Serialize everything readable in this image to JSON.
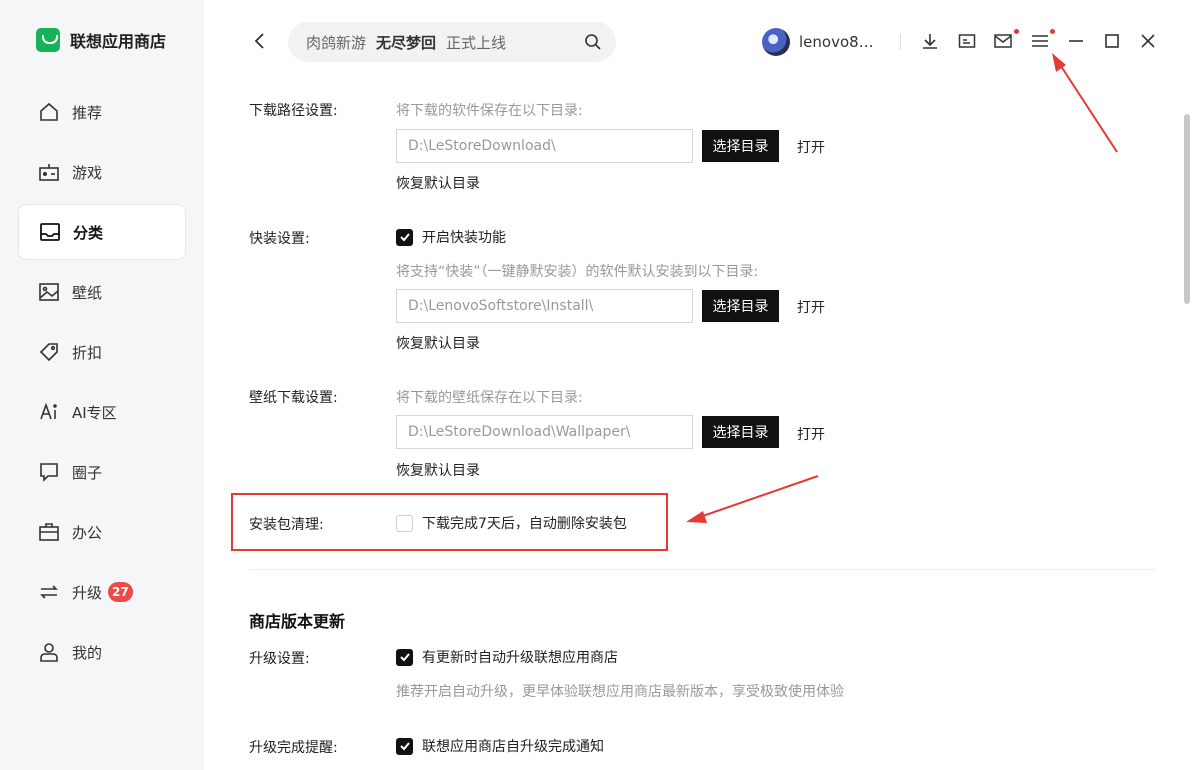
{
  "app": {
    "title": "联想应用商店"
  },
  "sidebar": {
    "items": [
      {
        "label": "推荐",
        "icon": "home-icon"
      },
      {
        "label": "游戏",
        "icon": "gamepad-icon"
      },
      {
        "label": "分类",
        "icon": "category-icon",
        "active": true
      },
      {
        "label": "壁纸",
        "icon": "image-icon"
      },
      {
        "label": "折扣",
        "icon": "tag-icon"
      },
      {
        "label": "AI专区",
        "icon": "ai-icon"
      },
      {
        "label": "圈子",
        "icon": "chat-icon"
      },
      {
        "label": "办公",
        "icon": "briefcase-icon"
      },
      {
        "label": "升级",
        "icon": "refresh-icon",
        "badge": "27"
      },
      {
        "label": "我的",
        "icon": "user-icon"
      }
    ]
  },
  "header": {
    "search": {
      "prefix": "肉鸽新游",
      "highlight": "无尽梦回",
      "suffix": "正式上线"
    },
    "username": "lenovo8…",
    "icons": [
      "download-icon",
      "message-box-icon",
      "mail-icon",
      "menu-icon",
      "minimize-icon",
      "maximize-icon",
      "close-icon"
    ]
  },
  "settings": {
    "download_path": {
      "label": "下载路径设置:",
      "hint": "将下载的软件保存在以下目录:",
      "value": "D:\\LeStoreDownload\\",
      "choose": "选择目录",
      "open": "打开",
      "restore": "恢复默认目录"
    },
    "quick_install": {
      "label": "快装设置:",
      "checkbox": "开启快装功能",
      "checked": true,
      "hint": "将支持“快装”（一键静默安装）的软件默认安装到以下目录:",
      "value": "D:\\LenovoSoftstore\\Install\\",
      "choose": "选择目录",
      "open": "打开",
      "restore": "恢复默认目录"
    },
    "wallpaper": {
      "label": "壁纸下载设置:",
      "hint": "将下载的壁纸保存在以下目录:",
      "value": "D:\\LeStoreDownload\\Wallpaper\\",
      "choose": "选择目录",
      "open": "打开",
      "restore": "恢复默认目录"
    },
    "cleanup": {
      "label": "安装包清理:",
      "checkbox": "下载完成7天后，自动删除安装包",
      "checked": false
    }
  },
  "store_update": {
    "title": "商店版本更新",
    "upgrade": {
      "label": "升级设置:",
      "checkbox": "有更新时自动升级联想应用商店",
      "checked": true,
      "hint": "推荐开启自动升级，更早体验联想应用商店最新版本，享受极致使用体验"
    },
    "notify": {
      "label": "升级完成提醒:",
      "checkbox": "联想应用商店自升级完成通知",
      "checked": true
    }
  },
  "colors": {
    "accent": "#16b35a",
    "annotation": "#e53935",
    "badge": "#ef4a4a"
  }
}
